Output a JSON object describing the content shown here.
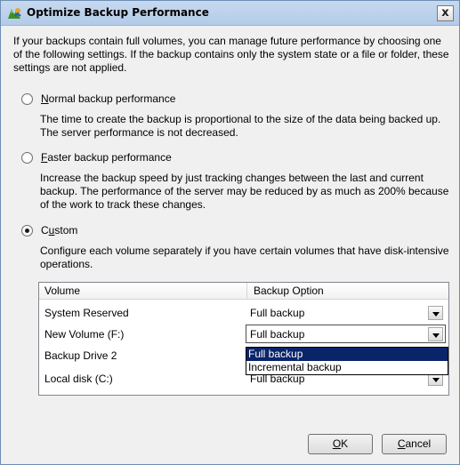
{
  "window": {
    "title": "Optimize Backup Performance",
    "close_label": "x"
  },
  "intro": "If your backups contain full volumes, you can manage future performance by choosing one of the following settings. If the backup contains only the system state or a file or folder, these settings are not applied.",
  "options": [
    {
      "label_mnemonic": "N",
      "label_rest": "ormal backup performance",
      "selected": false,
      "description": "The time to create the backup is proportional to the size of the data being backed up. The server performance is not decreased."
    },
    {
      "label_mnemonic": "F",
      "label_rest": "aster backup performance",
      "selected": false,
      "description": "Increase the backup speed by just tracking changes between the last and current backup. The performance of the server may be reduced by as much as 200% because of the work to track these changes."
    },
    {
      "label_prefix": "C",
      "label_mnemonic": "u",
      "label_rest": "stom",
      "selected": true,
      "description": "Configure each volume separately if you have certain volumes that have disk-intensive operations."
    }
  ],
  "grid": {
    "columns": [
      "Volume",
      "Backup Option"
    ],
    "rows": [
      {
        "volume": "System Reserved",
        "option": "Full backup"
      },
      {
        "volume": "New Volume (F:)",
        "option": "Full backup"
      },
      {
        "volume": "Backup Drive 2",
        "option": ""
      },
      {
        "volume": "Local disk (C:)",
        "option": "Full backup"
      }
    ],
    "dropdown_options": [
      "Full backup",
      "Incremental backup"
    ],
    "dropdown_selected_index": 0
  },
  "buttons": {
    "ok_mnemonic": "O",
    "ok_rest": "K",
    "cancel_mnemonic": "C",
    "cancel_rest": "ancel"
  },
  "colors": {
    "titlebar": "#b9cfea",
    "selection": "#0a246a",
    "dialog_bg": "#f0f0f0"
  }
}
